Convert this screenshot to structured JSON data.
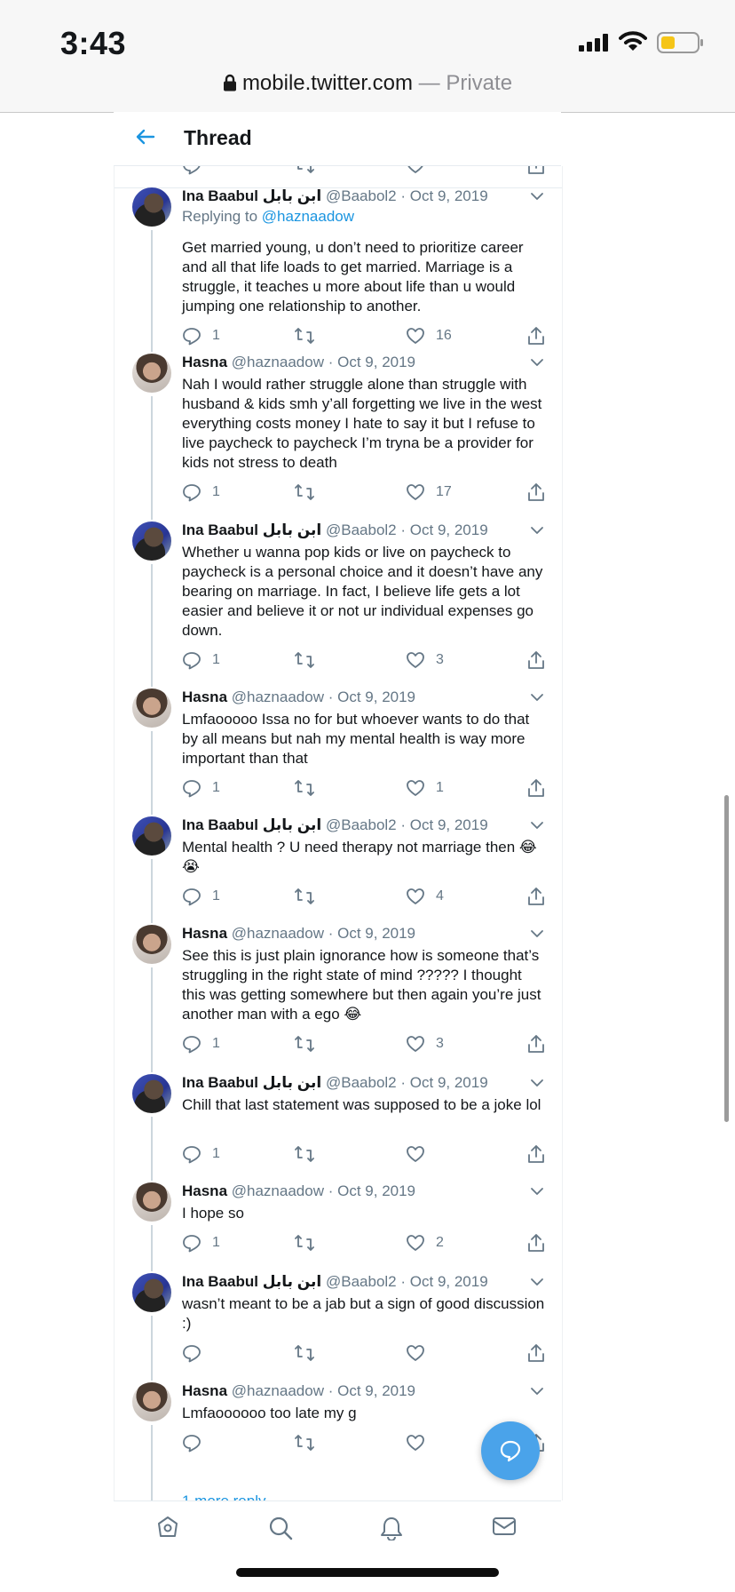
{
  "status": {
    "time": "3:43"
  },
  "browser": {
    "url": "mobile.twitter.com",
    "separator": "—",
    "mode": "Private"
  },
  "header": {
    "title": "Thread",
    "back_icon": "arrow-left-icon"
  },
  "colors": {
    "accent": "#1b95e0",
    "fab": "#4aa3ea",
    "secondary_text": "#657786",
    "line": "#ccd6dd"
  },
  "tweets": [
    {
      "name": "Ina Baabul ابن بابل",
      "handle": "@Baabol2",
      "sep": "·",
      "date": "Oct 9, 2019",
      "replying_label": "Replying to",
      "replying_to": "@haznaadow",
      "text": "Get married young, u don’t need to prioritize career and all that life loads to get married. Marriage is a struggle, it teaches u more about life than u would jumping one relationship to another.",
      "replies": "1",
      "retweets": "",
      "likes": "16"
    },
    {
      "name": "Hasna",
      "handle": "@haznaadow",
      "sep": "·",
      "date": "Oct 9, 2019",
      "text": "Nah I would rather struggle alone than struggle with husband & kids smh y’all forgetting we live in the west everything costs money I hate to say it but I refuse to live paycheck to paycheck I’m tryna be a provider for kids not stress to death",
      "replies": "1",
      "retweets": "",
      "likes": "17"
    },
    {
      "name": "Ina Baabul ابن بابل",
      "handle": "@Baabol2",
      "sep": "·",
      "date": "Oct 9, 2019",
      "text": "Whether u wanna pop kids or live on paycheck to paycheck is a personal choice and it doesn’t have any bearing on marriage. In fact, I believe life gets a lot easier and believe it or not ur individual expenses go down.",
      "replies": "1",
      "retweets": "",
      "likes": "3"
    },
    {
      "name": "Hasna",
      "handle": "@haznaadow",
      "sep": "·",
      "date": "Oct 9, 2019",
      "text": "Lmfaooooo Issa no for but whoever wants to do that by all means but nah my mental health is way more important than that",
      "replies": "1",
      "retweets": "",
      "likes": "1"
    },
    {
      "name": "Ina Baabul ابن بابل",
      "handle": "@Baabol2",
      "sep": "·",
      "date": "Oct 9, 2019",
      "text": "Mental health ? U need therapy not marriage then 😂😭",
      "replies": "1",
      "retweets": "",
      "likes": "4"
    },
    {
      "name": "Hasna",
      "handle": "@haznaadow",
      "sep": "·",
      "date": "Oct 9, 2019",
      "text": "See this is just plain ignorance how is someone that’s struggling in the right state of mind ????? I thought this was getting somewhere but then again you’re just another man with a ego 😂",
      "replies": "1",
      "retweets": "",
      "likes": "3"
    },
    {
      "name": "Ina Baabul ابن بابل",
      "handle": "@Baabol2",
      "sep": "·",
      "date": "Oct 9, 2019",
      "text": "Chill that last statement was supposed to be a joke lol",
      "replies": "1",
      "retweets": "",
      "likes": ""
    },
    {
      "name": "Hasna",
      "handle": "@haznaadow",
      "sep": "·",
      "date": "Oct 9, 2019",
      "text": "I hope so",
      "replies": "1",
      "retweets": "",
      "likes": "2"
    },
    {
      "name": "Ina Baabul ابن بابل",
      "handle": "@Baabol2",
      "sep": "·",
      "date": "Oct 9, 2019",
      "text": "wasn’t meant to be a jab but a sign of good discussion :)",
      "replies": "",
      "retweets": "",
      "likes": ""
    },
    {
      "name": "Hasna",
      "handle": "@haznaadow",
      "sep": "·",
      "date": "Oct 9, 2019",
      "text": "Lmfaoooooo too late my g",
      "replies": "",
      "retweets": "",
      "likes": ""
    }
  ],
  "more_reply": "1 more reply",
  "nav": {
    "home": "home-icon",
    "search": "search-icon",
    "notifications": "bell-icon",
    "messages": "mail-icon"
  }
}
